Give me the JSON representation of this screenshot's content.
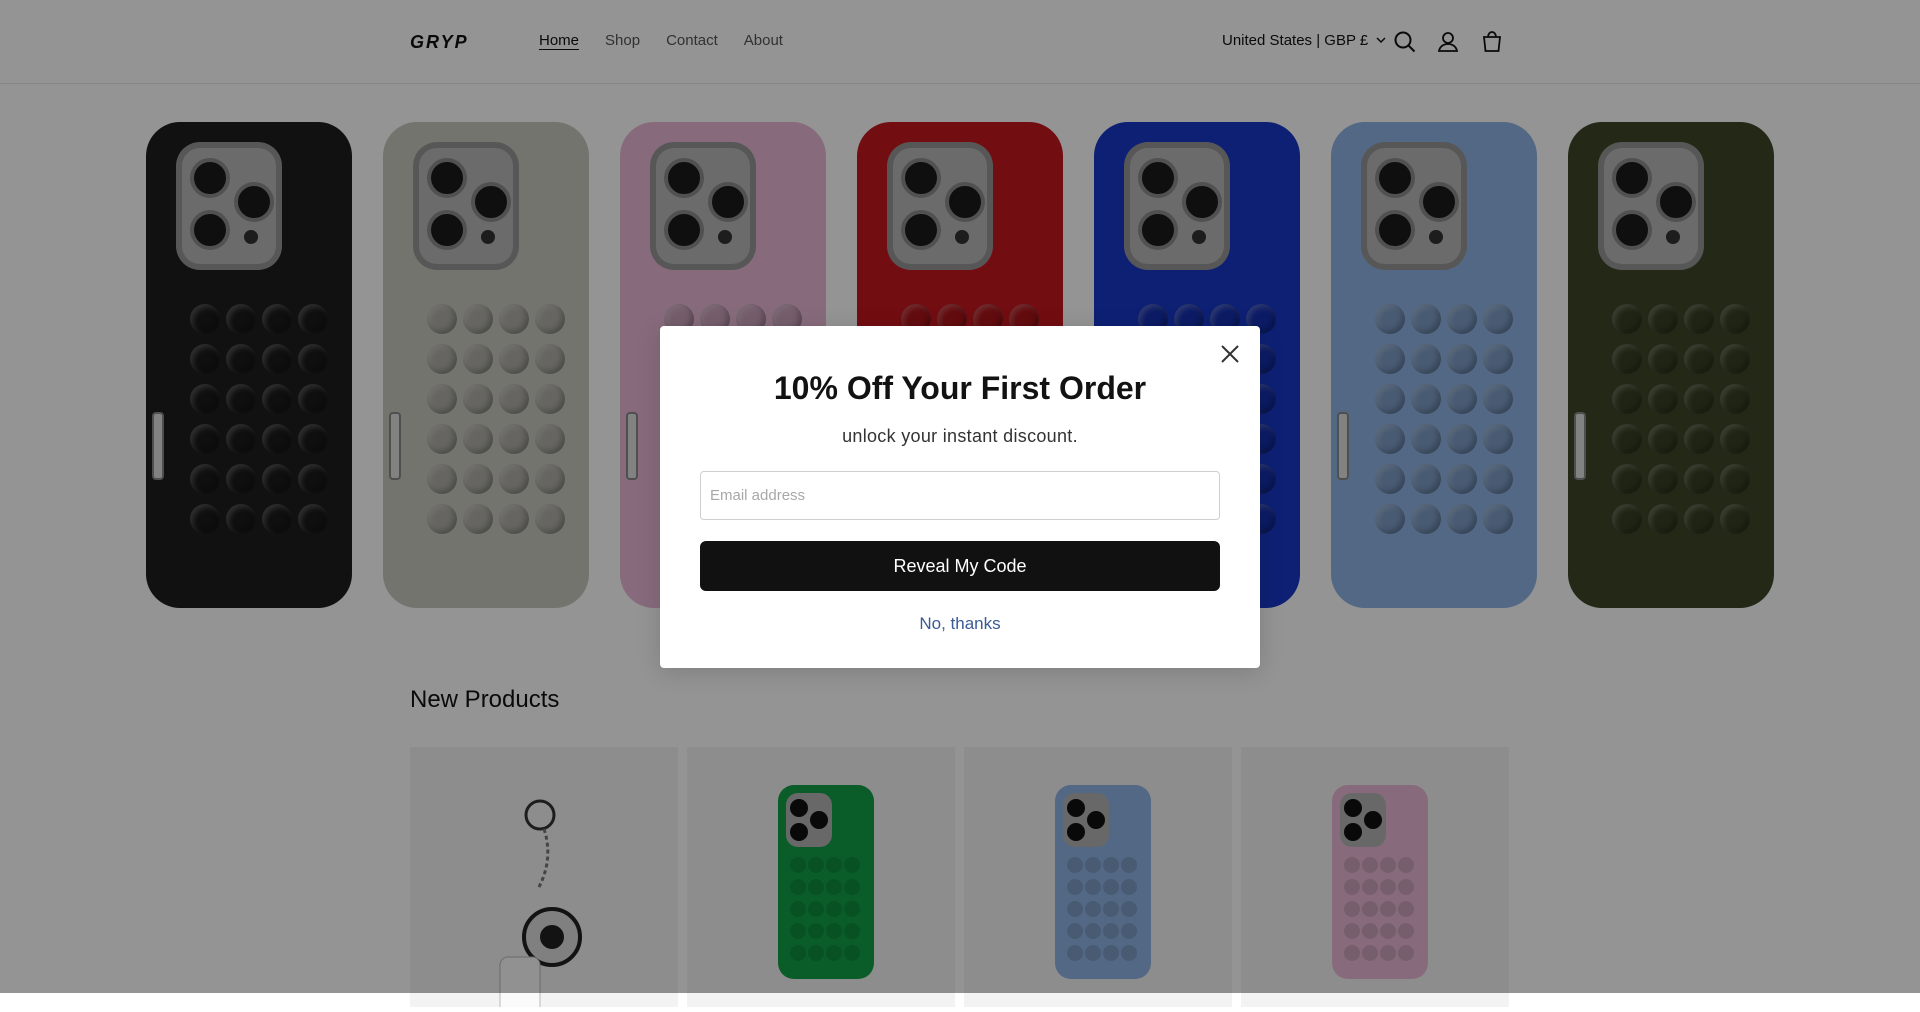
{
  "header": {
    "logo_text": "GRYP",
    "nav": [
      {
        "label": "Home",
        "active": true
      },
      {
        "label": "Shop",
        "active": false
      },
      {
        "label": "Contact",
        "active": false
      },
      {
        "label": "About",
        "active": false
      }
    ],
    "country_selector": "United States | GBP £",
    "icons": [
      "search-icon",
      "account-icon",
      "cart-icon"
    ]
  },
  "hero": {
    "cases": [
      {
        "color": "#1e1e1e"
      },
      {
        "color": "#c9c8bf"
      },
      {
        "color": "#e9b9d6"
      },
      {
        "color": "#c5181e"
      },
      {
        "color": "#1837c8"
      },
      {
        "color": "#8fb3e3"
      },
      {
        "color": "#3e4828"
      }
    ]
  },
  "products": {
    "title": "New Products",
    "items": [
      {
        "kind": "keychain",
        "color": "#ffffff"
      },
      {
        "kind": "case",
        "color": "#12a046"
      },
      {
        "kind": "case",
        "color": "#8fb3e3"
      },
      {
        "kind": "case",
        "color": "#e9b9d6"
      }
    ]
  },
  "modal": {
    "title": "10% Off Your First Order",
    "subtitle": "unlock your instant discount.",
    "email_placeholder": "Email address",
    "email_value": "",
    "button_label": "Reveal My Code",
    "dismiss_label": "No, thanks"
  },
  "colors": {
    "overlay": "rgba(0,0,0,0.42)",
    "button_bg": "#111111",
    "link": "#3b5a95"
  }
}
